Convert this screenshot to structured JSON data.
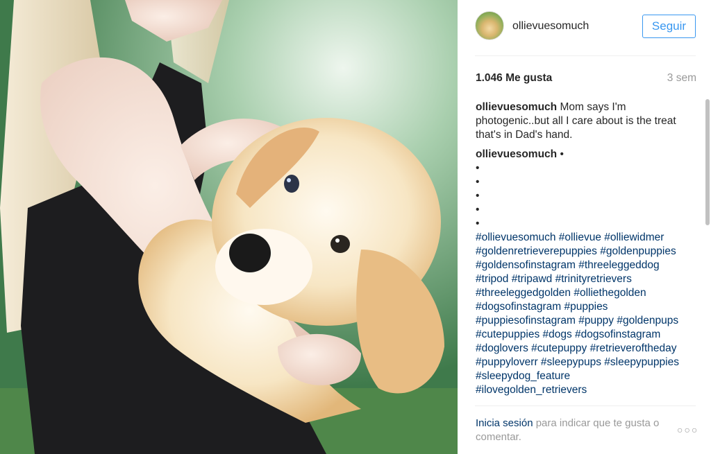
{
  "post": {
    "username": "ollievuesomuch",
    "follow_label": "Seguir",
    "likes": "1.046 Me gusta",
    "time_ago": "3 sem",
    "caption": "Mom says I'm photogenic..but all I care about is the treat that's in Dad's hand.",
    "comment_username": "ollievuesomuch",
    "comment_after_name": "•",
    "bullets": [
      "•",
      "•",
      "•",
      "•",
      "•"
    ],
    "hashtags": "#ollievuesomuch #ollievue #olliewidmer #goldenretrieverepuppies #goldenpuppies #goldensofinstagram #threeleggeddog #tripod #tripawd #trinityretrievers #threeleggedgolden #olliethegolden #dogsofinstagram #puppies #puppiesofinstagram #puppy #goldenpups #cutepuppies #dogs #dogsofinstagram #doglovers #cutepuppy #retrieveroftheday #puppyloverr #sleepypups #sleepypuppies #sleepydog_feature #ilovegolden_retrievers"
  },
  "footer": {
    "login_link": "Inicia sesión",
    "login_text": " para indicar que te gusta o comentar.",
    "more_label": "○○○"
  },
  "icons": {
    "more": "more-options-icon",
    "avatar": "profile-avatar"
  },
  "colors": {
    "accent": "#3897f0",
    "link": "#003569",
    "muted": "#999999"
  }
}
